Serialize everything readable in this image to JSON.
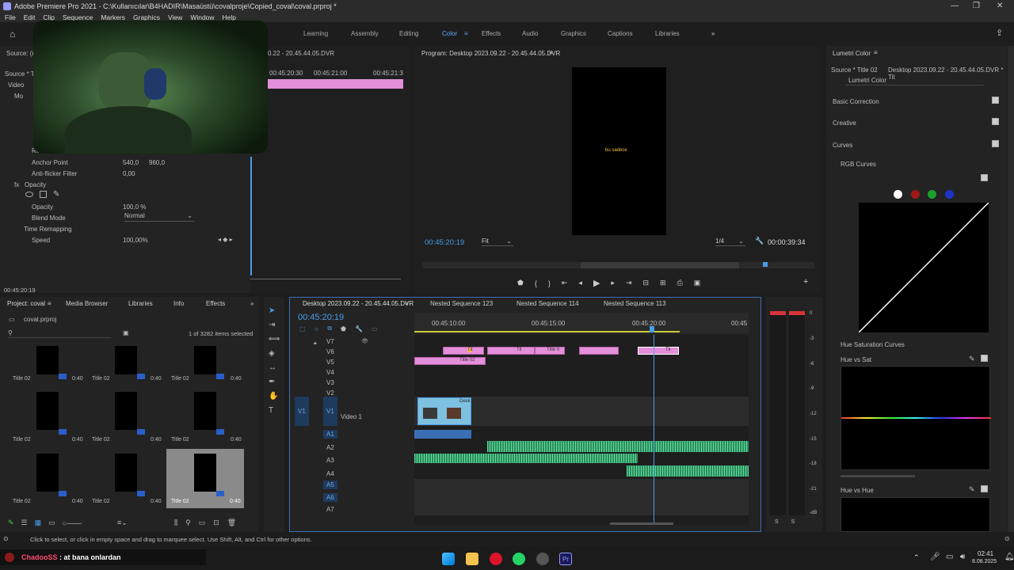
{
  "window": {
    "title": "Adobe Premiere Pro 2021 - C:\\Kullanıcılar\\B4HADIR\\Masaüstü\\covalproje\\Copied_coval\\coval.prproj *"
  },
  "menu": [
    "File",
    "Edit",
    "Clip",
    "Sequence",
    "Markers",
    "Graphics",
    "View",
    "Window",
    "Help"
  ],
  "workspaces": [
    "Learning",
    "Assembly",
    "Editing",
    "Color",
    "Effects",
    "Audio",
    "Graphics",
    "Captions",
    "Libraries"
  ],
  "effect_controls": {
    "source_short": "Source: (n",
    "source2": "Source * T",
    "video": "Video",
    "mo": "Mo",
    "rotation": "Rotation",
    "anchor_label": "Anchor Point",
    "anchor_x": "540,0",
    "anchor_y": "960,0",
    "antiflicker_label": "Anti-flicker Filter",
    "antiflicker_val": "0,00",
    "opacity_section": "Opacity",
    "opacity_label": "Opacity",
    "opacity_val": "100,0 %",
    "blend_label": "Blend Mode",
    "blend_val": "Normal",
    "timeremap": "Time Remapping",
    "speed_label": "Speed",
    "speed_val": "100,00%",
    "timecode": "00:45:20:19",
    "mini_tc1": "00:45:20:30",
    "mini_tc2": "00:45:21:00",
    "mini_tc3": "00:45:21:3",
    "mini_date": "0.22 - 20.45.44.05.DVR"
  },
  "program": {
    "title": "Program: Desktop 2023.09.22 - 20.45.44.05.DVR",
    "overlay": "bu sadece",
    "timecode": "00:45:20:19",
    "fit": "Fit",
    "scale": "1/4",
    "duration": "00:00:39:34"
  },
  "lumetri": {
    "title": "Lumetri Color",
    "source": "Source * Title 02",
    "seq": "Desktop 2023.09.22 - 20.45.44.05.DVR * Tit",
    "effect": "Lumetri Color",
    "sections": [
      "Basic Correction",
      "Creative",
      "Curves"
    ],
    "rgb_curves": "RGB Curves",
    "hue_sat_curves": "Hue Saturation Curves",
    "hue_vs_sat": "Hue vs Sat",
    "hue_vs_hue": "Hue vs Hue"
  },
  "project": {
    "tabs": [
      "Project: coval",
      "Media Browser",
      "Libraries",
      "Info",
      "Effects"
    ],
    "file": "coval.prproj",
    "count": "1 of 3282 items selected",
    "items": [
      {
        "name": "Title 02",
        "dur": "0:40"
      },
      {
        "name": "Title 02",
        "dur": "0:40"
      },
      {
        "name": "Title 02",
        "dur": "0:40"
      },
      {
        "name": "Title 02",
        "dur": "0:40"
      },
      {
        "name": "Title 02",
        "dur": "0:40"
      },
      {
        "name": "Title 02",
        "dur": "0:40"
      },
      {
        "name": "Title 02",
        "dur": "0:40"
      },
      {
        "name": "Title 02",
        "dur": "0:40"
      },
      {
        "name": "Title 02",
        "dur": "0:40"
      }
    ]
  },
  "timeline": {
    "tabs": [
      "Desktop 2023.09.22 - 20.45.44.05.DVR",
      "Nested Sequence 123",
      "Nested Sequence 114",
      "Nested Sequence 113"
    ],
    "timecode": "00:45:20:19",
    "ruler": [
      "00:45:10:00",
      "00:45:15:00",
      "00:45:20:00",
      "00:45"
    ],
    "video_tracks": [
      "V7",
      "V6",
      "V5",
      "V4",
      "V3",
      "V2",
      "V1"
    ],
    "audio_tracks": [
      "A1",
      "A2",
      "A3",
      "A4",
      "A5",
      "A6",
      "A7"
    ],
    "video1": "Video 1",
    "clip_title02": "Title 02",
    "clip_title0": "Title 0",
    "clip_tit": "Tit",
    "clip_desk": "Desk",
    "clip_tit2": "Tit"
  },
  "meters": [
    "0",
    "-3",
    "-6",
    "-9",
    "-12",
    "-15",
    "-18",
    "-21",
    "-dB"
  ],
  "meter_ss": "S S",
  "status": "Click to select, or click in empty space and drag to marquee select. Use Shift, Alt, and Ctrl for other options.",
  "chat": {
    "user": "ChadooSS",
    "msg": ": at bana onlardan"
  },
  "clock": {
    "time": "02:41",
    "date": "8.08.2025"
  }
}
